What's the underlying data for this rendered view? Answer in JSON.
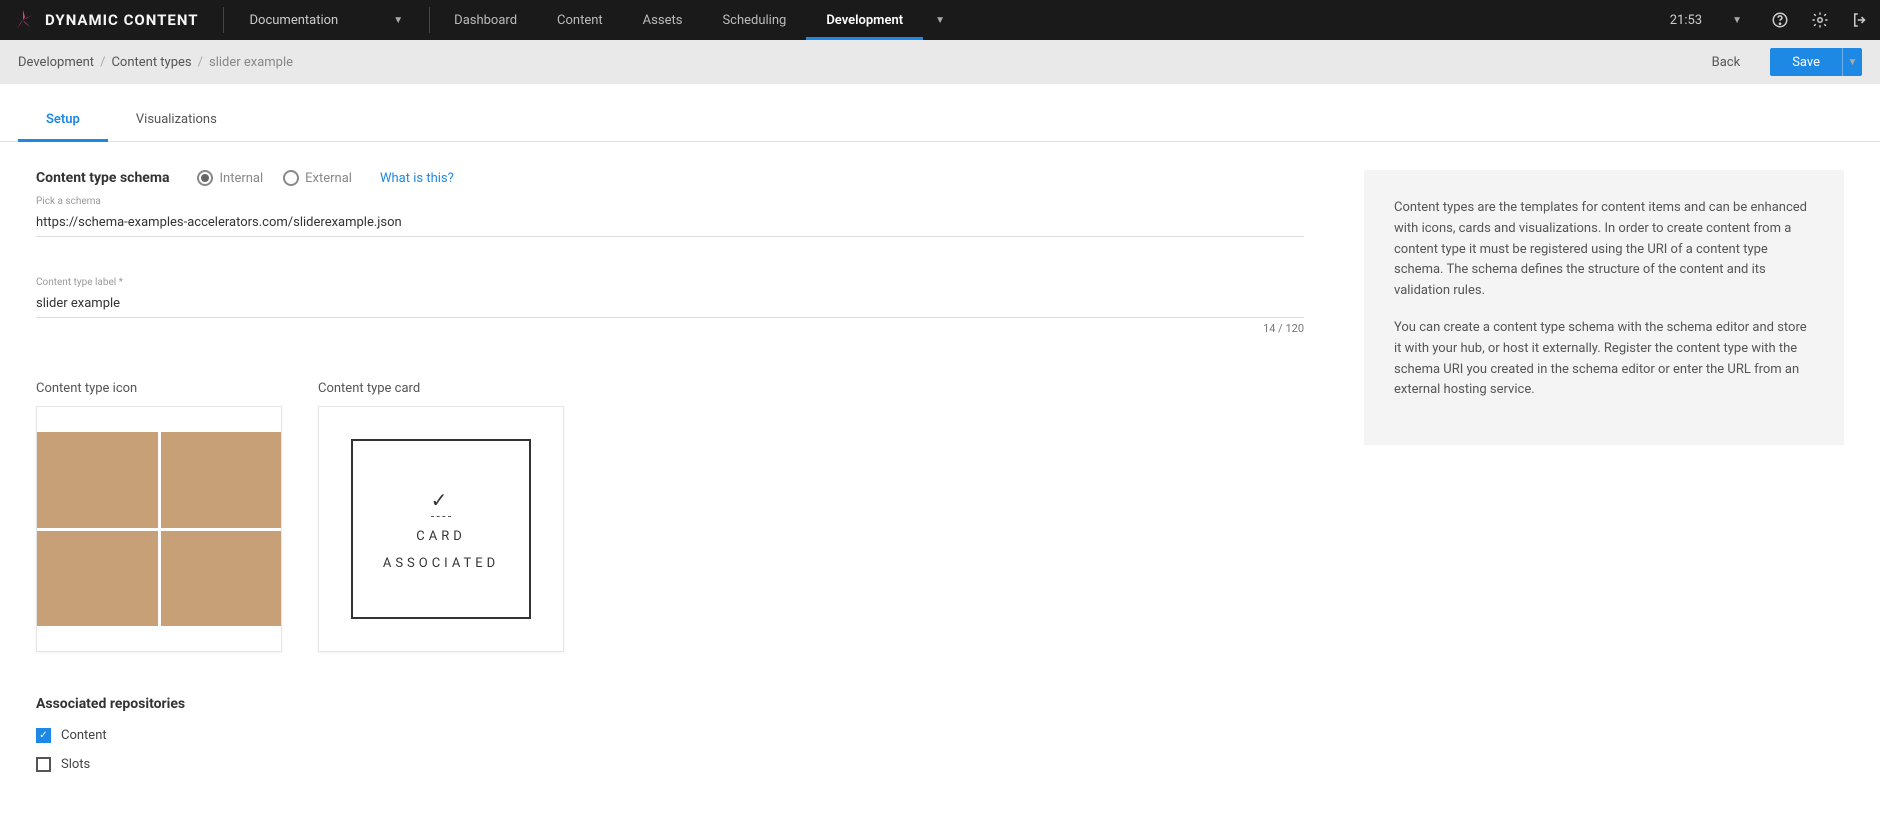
{
  "brand": "DYNAMIC CONTENT",
  "nav_dropdown": "Documentation",
  "nav_tabs": [
    "Dashboard",
    "Content",
    "Assets",
    "Scheduling",
    "Development"
  ],
  "nav_active_index": 4,
  "time": "21:53",
  "breadcrumb": {
    "root": "Development",
    "mid": "Content types",
    "current": "slider example"
  },
  "back_label": "Back",
  "save_label": "Save",
  "main_tabs": [
    "Setup",
    "Visualizations"
  ],
  "main_tab_active_index": 0,
  "schema_heading": "Content type schema",
  "radios": {
    "internal": "Internal",
    "external": "External"
  },
  "what_link": "What is this?",
  "schema_field": {
    "label": "Pick a schema",
    "value": "https://schema-examples-accelerators.com/sliderexample.json"
  },
  "label_field": {
    "label": "Content type label *",
    "value": "slider example",
    "count": "14 / 120"
  },
  "icon_label": "Content type icon",
  "card_label": "Content type card",
  "card_assoc": {
    "line1": "CARD",
    "line2": "ASSOCIATED"
  },
  "assoc_heading": "Associated repositories",
  "repos": [
    {
      "label": "Content",
      "checked": true
    },
    {
      "label": "Slots",
      "checked": false
    }
  ],
  "help": {
    "p1": "Content types are the templates for content items and can be enhanced with icons, cards and visualizations. In order to create content from a content type it must be registered using the URI of a content type schema. The schema defines the structure of the content and its validation rules.",
    "p2": "You can create a content type schema with the schema editor and store it with your hub, or host it externally. Register the content type with the schema URI you created in the schema editor or enter the URL from an external hosting service."
  }
}
